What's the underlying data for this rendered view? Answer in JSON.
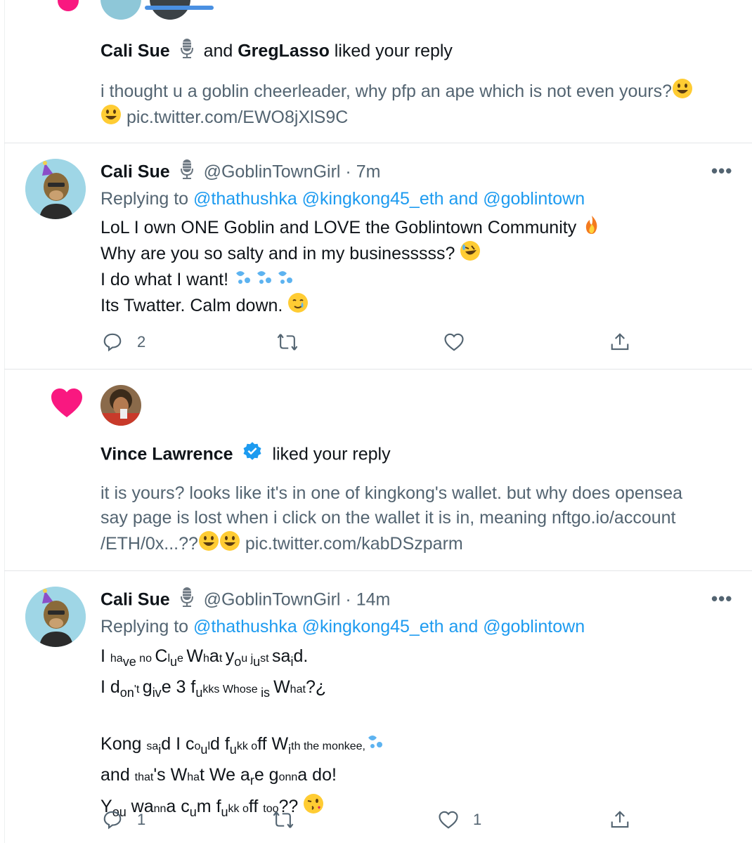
{
  "notif1": {
    "name1": "Cali Sue",
    "and": "and",
    "name2": "GregLasso",
    "action": "liked your reply",
    "text": "i thought u a goblin cheerleader, why pfp an ape which is not even yours?",
    "link": "pic.twitter.com/EWO8jXlS9C"
  },
  "tweet1": {
    "name": "Cali Sue",
    "handle": "@GoblinTownGirl",
    "dot": "·",
    "time": "7m",
    "replying_label": "Replying to",
    "replying_users": "@thathushka @kingkong45_eth and @goblintown",
    "line1": "LoL I own ONE Goblin and LOVE the Goblintown Community",
    "line2": "Why are you so salty and in my businesssss?",
    "line3": "I do what I want!",
    "line4": "Its Twatter. Calm down.",
    "reply_count": "2"
  },
  "notif2": {
    "name": "Vince Lawrence",
    "action": "liked your reply",
    "text_line1": "it is yours? looks like it's in one of kingkong's wallet. but why does opensea",
    "text_line2": "say page is lost when i click on the wallet it is in, meaning nftgo.io/account",
    "text_line3": "/ETH/0x...??",
    "link": "pic.twitter.com/kabDSzparm"
  },
  "tweet2": {
    "name": "Cali Sue",
    "handle": "@GoblinTownGirl",
    "dot": "·",
    "time": "14m",
    "replying_label": "Replying to",
    "replying_users": "@thathushka @kingkong45_eth and @goblintown",
    "wavy": {
      "l1": [
        "I ",
        "ha",
        "ve",
        " no ",
        "C",
        "l",
        "u",
        "e ",
        "W",
        "h",
        "a",
        "t ",
        "y",
        "o",
        "u",
        "  j",
        "u",
        "st ",
        "sa",
        "i",
        "d."
      ],
      "l2": [
        "I d",
        "on",
        "'",
        "t ",
        "g",
        "iv",
        "e 3 f",
        "u",
        "kks ",
        "Whose ",
        "is ",
        "W",
        "h",
        "a",
        "t",
        "?¿"
      ],
      "l4": [
        "K",
        "ong ",
        "sa",
        "i",
        "d I c",
        "o",
        "u",
        "l",
        "d f",
        "u",
        "kk ",
        "o",
        "ff W",
        "i",
        "th the monkee,"
      ],
      "l5": [
        "a",
        "n",
        "d ",
        "th",
        "a",
        "t",
        "'s W",
        "h",
        "a",
        "t W",
        "e a",
        "r",
        "e g",
        "onn",
        "a d",
        "o!"
      ],
      "l6": [
        " Y",
        "o",
        "u",
        " wa",
        "nn",
        "a c",
        "u",
        "m f",
        "u",
        "kk ",
        "o",
        "ff ",
        "too",
        "?? "
      ]
    },
    "reply_count": "1",
    "like_count": "1"
  },
  "icons": [
    "reply-icon",
    "retweet-icon",
    "like-icon",
    "share-icon",
    "heart-icon",
    "verified-icon",
    "mic-icon",
    "more-icon"
  ]
}
